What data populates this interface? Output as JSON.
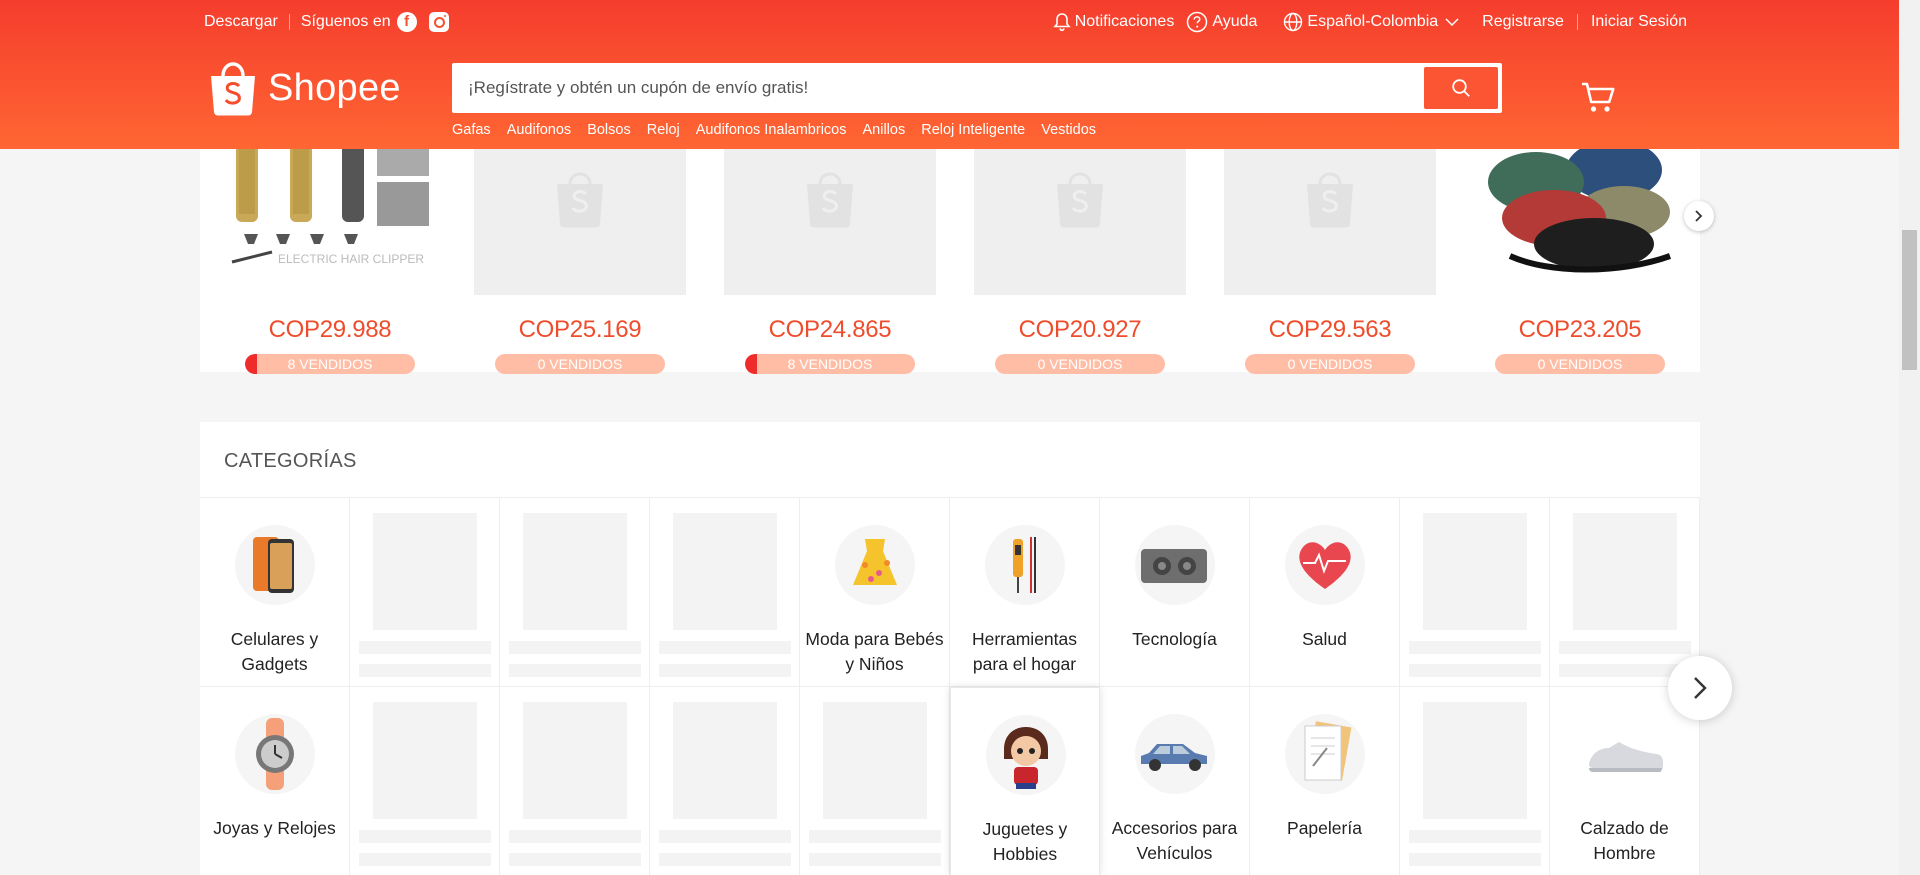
{
  "topbar": {
    "download": "Descargar",
    "follow": "Síguenos en",
    "facebook_icon": "facebook-icon",
    "instagram_icon": "instagram-icon",
    "notifications": "Notificaciones",
    "help": "Ayuda",
    "language": "Español-Colombia",
    "register": "Registrarse",
    "login": "Iniciar Sesión"
  },
  "brand": {
    "name": "Shopee",
    "color": "#ee4d2d"
  },
  "search": {
    "placeholder": "¡Regístrate y obtén un cupón de envío gratis!",
    "value": "",
    "suggestions": [
      "Gafas",
      "Audifonos",
      "Bolsos",
      "Reloj",
      "Audifonos Inalambricos",
      "Anillos",
      "Reloj Inteligente",
      "Vestidos"
    ]
  },
  "flash_products": [
    {
      "currency": "COP",
      "price": "29.988",
      "sold_label": "8 VENDIDOS",
      "sold_fraction": 0.07,
      "image": "hair-clipper"
    },
    {
      "currency": "COP",
      "price": "25.169",
      "sold_label": "0 VENDIDOS",
      "sold_fraction": 0,
      "image": "placeholder"
    },
    {
      "currency": "COP",
      "price": "24.865",
      "sold_label": "8 VENDIDOS",
      "sold_fraction": 0.07,
      "image": "placeholder"
    },
    {
      "currency": "COP",
      "price": "20.927",
      "sold_label": "0 VENDIDOS",
      "sold_fraction": 0,
      "image": "placeholder"
    },
    {
      "currency": "COP",
      "price": "29.563",
      "sold_label": "0 VENDIDOS",
      "sold_fraction": 0,
      "image": "placeholder"
    },
    {
      "currency": "COP",
      "price": "23.205",
      "sold_label": "0 VENDIDOS",
      "sold_fraction": 0,
      "image": "caps"
    }
  ],
  "categories": {
    "title": "CATEGORÍAS",
    "row1": [
      {
        "name": "Celulares y Gadgets",
        "icon": "phone-icon"
      },
      {
        "name": "",
        "icon": ""
      },
      {
        "name": "",
        "icon": ""
      },
      {
        "name": "",
        "icon": ""
      },
      {
        "name": "Moda para Bebés y Niños",
        "icon": "baby-dress-icon"
      },
      {
        "name": "Herramientas para el hogar",
        "icon": "tools-icon"
      },
      {
        "name": "Tecnología",
        "icon": "speaker-icon"
      },
      {
        "name": "Salud",
        "icon": "heart-icon"
      },
      {
        "name": "",
        "icon": ""
      },
      {
        "name": "",
        "icon": ""
      }
    ],
    "row2": [
      {
        "name": "Joyas y Relojes",
        "icon": "watch-icon"
      },
      {
        "name": "",
        "icon": ""
      },
      {
        "name": "",
        "icon": ""
      },
      {
        "name": "",
        "icon": ""
      },
      {
        "name": "",
        "icon": ""
      },
      {
        "name": "Juguetes y Hobbies",
        "icon": "figure-icon"
      },
      {
        "name": "Accesorios para Vehículos",
        "icon": "car-icon"
      },
      {
        "name": "Papelería",
        "icon": "notebook-icon"
      },
      {
        "name": "",
        "icon": ""
      },
      {
        "name": "Calzado de Hombre",
        "icon": "shoe-icon"
      }
    ]
  }
}
